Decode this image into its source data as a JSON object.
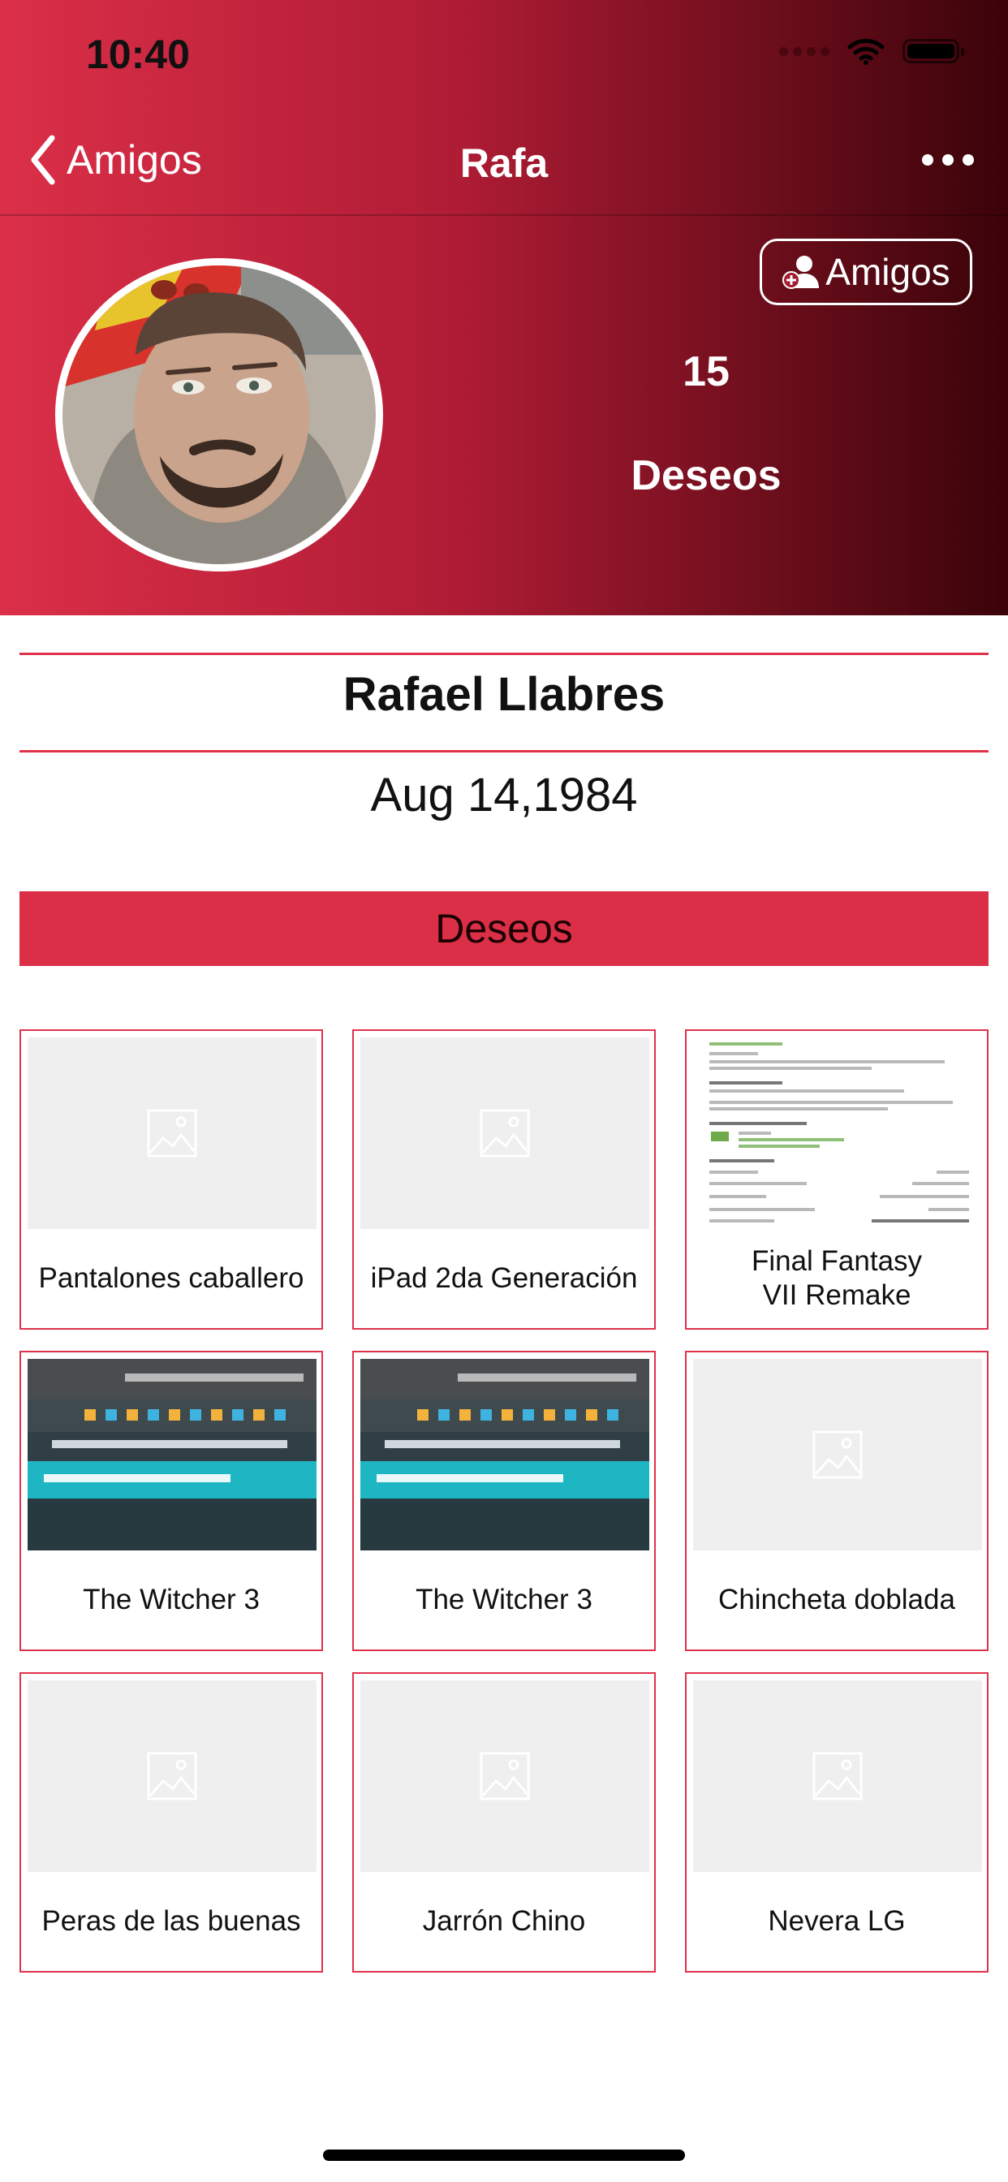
{
  "status_bar": {
    "time": "10:40"
  },
  "nav": {
    "back_label": "Amigos",
    "title": "Rafa"
  },
  "profile": {
    "friends_button_label": "Amigos",
    "wish_count": "15",
    "wish_count_label": "Deseos",
    "full_name": "Rafael Llabres",
    "birth_date": "Aug 14,1984"
  },
  "section": {
    "title": "Deseos"
  },
  "wishes": [
    {
      "name": "Pantalones caballero",
      "thumb": "placeholder"
    },
    {
      "name": "iPad 2da Generación",
      "thumb": "placeholder"
    },
    {
      "name": "Final Fantasy\nVII Remake",
      "thumb": "document"
    },
    {
      "name": "The Witcher 3",
      "thumb": "screenshot"
    },
    {
      "name": "The Witcher 3",
      "thumb": "screenshot"
    },
    {
      "name": "Chincheta doblada",
      "thumb": "placeholder"
    },
    {
      "name": "Peras de las buenas",
      "thumb": "placeholder"
    },
    {
      "name": "Jarrón Chino",
      "thumb": "placeholder"
    },
    {
      "name": "Nevera LG",
      "thumb": "placeholder"
    }
  ],
  "colors": {
    "accent": "#db2f48",
    "header_dark": "#3a0309",
    "card_border": "#e0314b",
    "thumb_bg": "#efefef"
  },
  "icons": {
    "back": "chevron-left-icon",
    "more": "more-horizontal-icon",
    "add_friend": "person-plus-icon",
    "image_placeholder": "image-icon",
    "wifi": "wifi-icon",
    "battery": "battery-icon",
    "signal": "signal-icon"
  }
}
